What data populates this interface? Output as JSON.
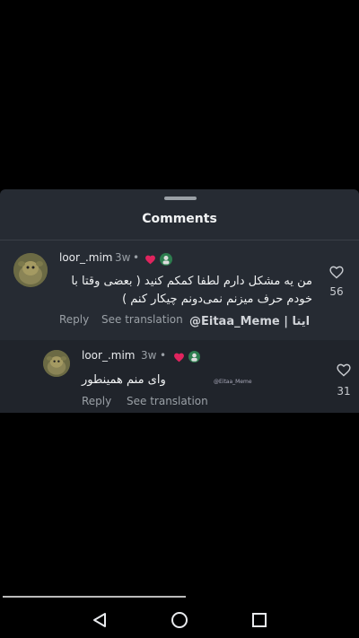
{
  "sheet": {
    "title": "Comments"
  },
  "comments": [
    {
      "username": "loor_.mim",
      "time": "3w",
      "separator": "•",
      "text_line1": "من یه مشکل دارم لطفا کمکم کنید ( بعضی وقتا با",
      "text_line2": "خودم حرف میزنم نمی‌دونم چیکار کنم )",
      "reply_label": "Reply",
      "translate_label": "See translation",
      "like_count": "56",
      "watermark": "@Eitaa_Meme | ایتا"
    },
    {
      "username": "loor_.mim",
      "time": "3w",
      "separator": "•",
      "text_line1": "وای منم همینطور",
      "reply_label": "Reply",
      "translate_label": "See translation",
      "like_count": "31",
      "watermark": "@Eitaa_Meme"
    }
  ],
  "colors": {
    "heart_red": "#e0245e",
    "sheet_bg": "#262b33"
  },
  "icons": {
    "heart_outline": "heart-outline-icon",
    "heart_filled": "heart-filled-icon",
    "back": "back-triangle-icon",
    "home": "home-circle-icon",
    "recents": "recents-square-icon"
  }
}
